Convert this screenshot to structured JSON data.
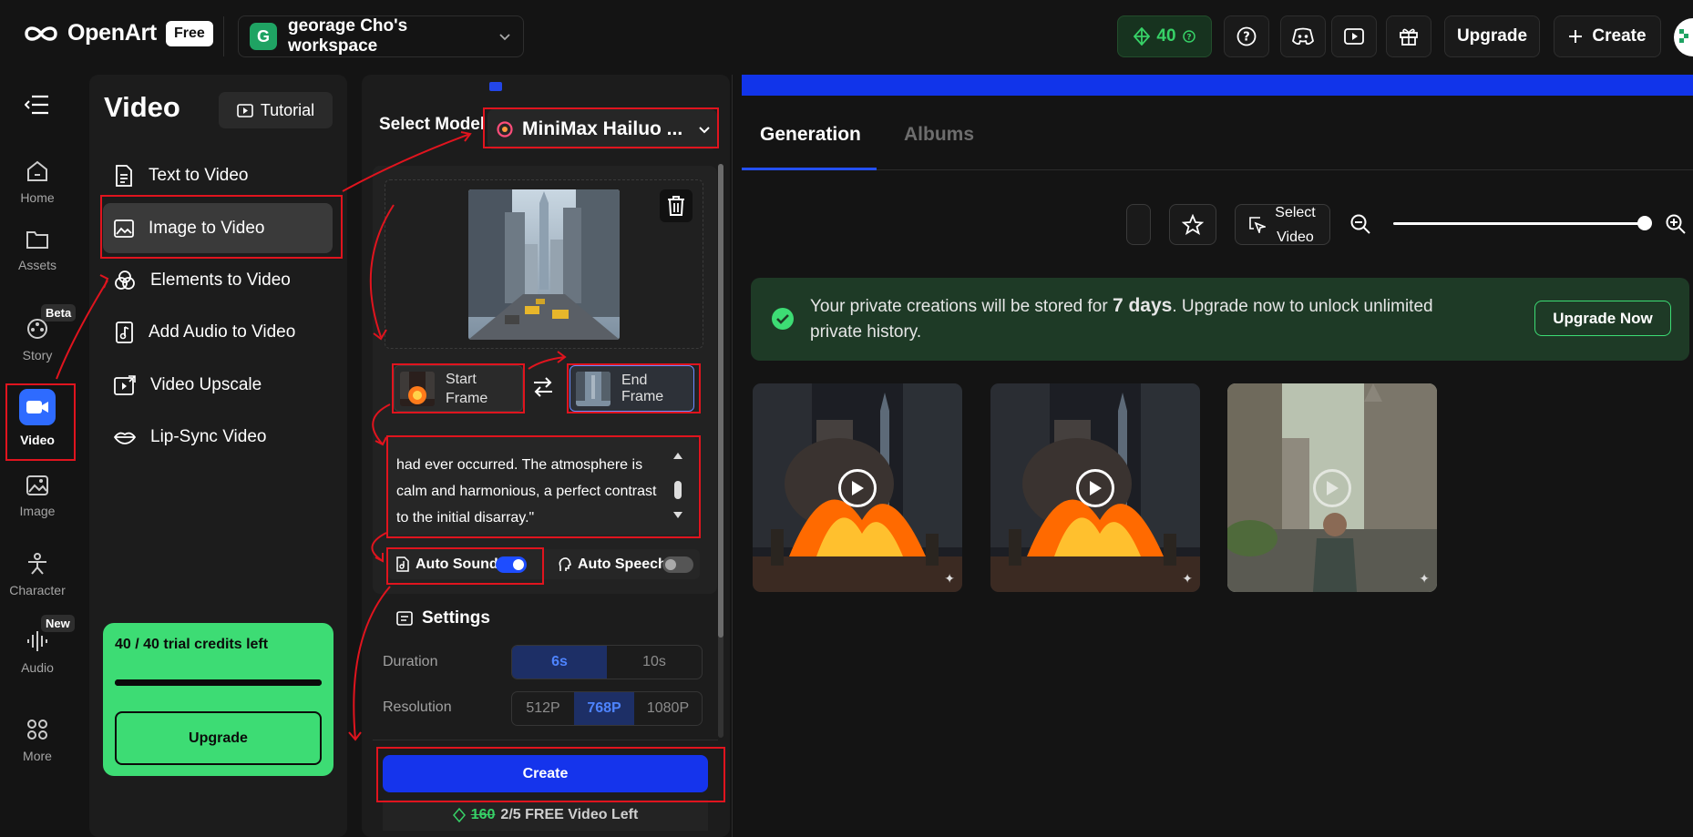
{
  "brand": {
    "name": "OpenArt",
    "plan_badge": "Free"
  },
  "workspace": {
    "initial": "G",
    "name": "georage Cho's workspace"
  },
  "header": {
    "credits": "40",
    "upgrade_label": "Upgrade",
    "create_label": "Create"
  },
  "rail": {
    "items": [
      {
        "label": "Home"
      },
      {
        "label": "Assets"
      },
      {
        "label": "Story",
        "badge": "Beta"
      },
      {
        "label": "Video"
      },
      {
        "label": "Image"
      },
      {
        "label": "Character"
      },
      {
        "label": "Audio",
        "badge": "New"
      },
      {
        "label": "More"
      }
    ]
  },
  "menu": {
    "title": "Video",
    "tutorial_label": "Tutorial",
    "items": [
      {
        "label": "Text to Video"
      },
      {
        "label": "Image to Video"
      },
      {
        "label": "Elements to Video"
      },
      {
        "label": "Add Audio to Video"
      },
      {
        "label": "Video Upscale"
      },
      {
        "label": "Lip-Sync Video"
      }
    ],
    "trial": {
      "text": "40 / 40 trial credits left",
      "progress": 1.0,
      "upgrade_label": "Upgrade"
    }
  },
  "form": {
    "select_model_label": "Select Model",
    "model_name": "MiniMax Hailuo ...",
    "start_frame_label": "Start\nFrame",
    "end_frame_label": "End Frame",
    "prompt_text": "had ever occurred. The atmosphere is calm and harmonious, a perfect contrast to the initial disarray.\"",
    "auto_sound_label": "Auto Sound",
    "auto_sound_on": true,
    "auto_speech_label": "Auto Speech",
    "auto_speech_on": false,
    "settings_title": "Settings",
    "duration_label": "Duration",
    "duration_options": [
      "6s",
      "10s"
    ],
    "duration_selected": "6s",
    "resolution_label": "Resolution",
    "resolution_options": [
      "512P",
      "768P",
      "1080P"
    ],
    "resolution_selected": "768P",
    "create_label": "Create",
    "free_old": "160",
    "free_text": "2/5 FREE Video Left"
  },
  "results": {
    "tabs": [
      {
        "label": "Generation",
        "active": true
      },
      {
        "label": "Albums",
        "active": false
      }
    ],
    "select_video_label": "Select\nVideo",
    "notice_pre": "Your private creations will be stored for ",
    "notice_bold": "7 days",
    "notice_post": ". Upgrade now to unlock unlimited private history.",
    "upgrade_now_label": "Upgrade Now"
  },
  "colors": {
    "accent_blue": "#1534ec",
    "brand_green": "#3ddc74",
    "annotation_red": "#e0141e"
  }
}
